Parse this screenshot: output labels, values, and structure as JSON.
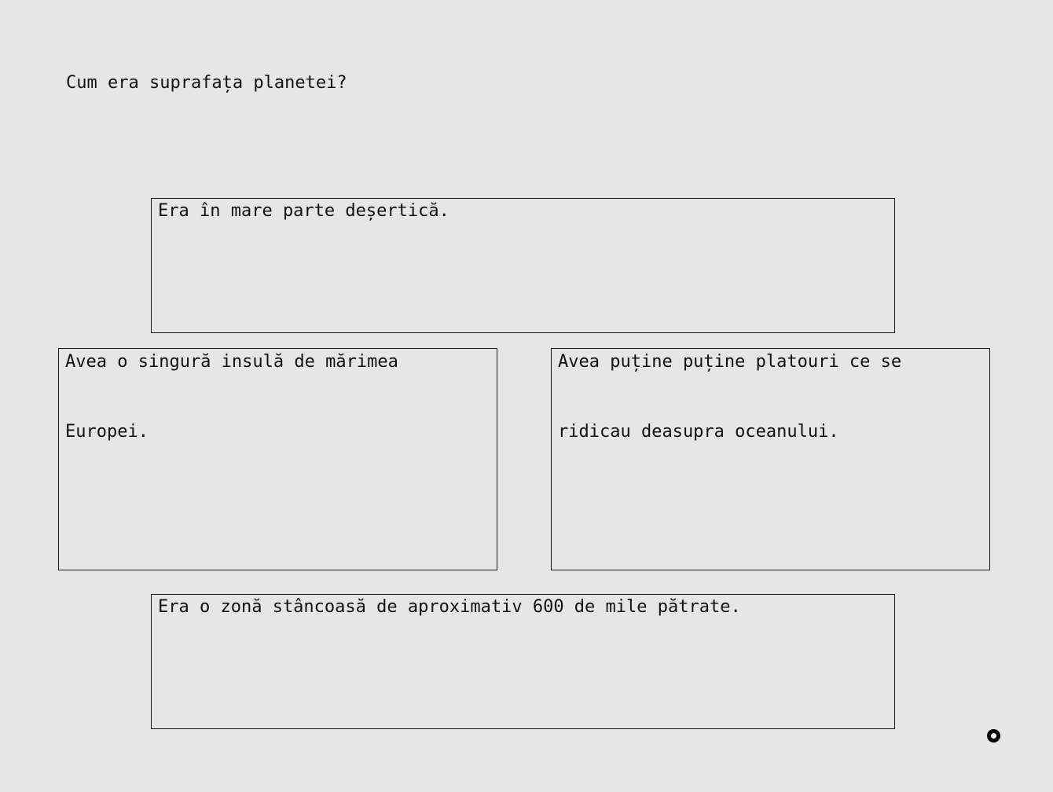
{
  "question": "Cum era suprafața planetei?",
  "answers": [
    {
      "text": "Era în mare parte deșertică."
    },
    {
      "text": "Avea o singură insulă de mărimea Europei."
    },
    {
      "text": "Avea puține puține platouri ce se ridicau deasupra oceanului."
    },
    {
      "text": "Era o zonă stâncoasă de aproximativ 600 de mile pătrate."
    }
  ],
  "cursor": {
    "icon": "cursor-ring-icon"
  }
}
